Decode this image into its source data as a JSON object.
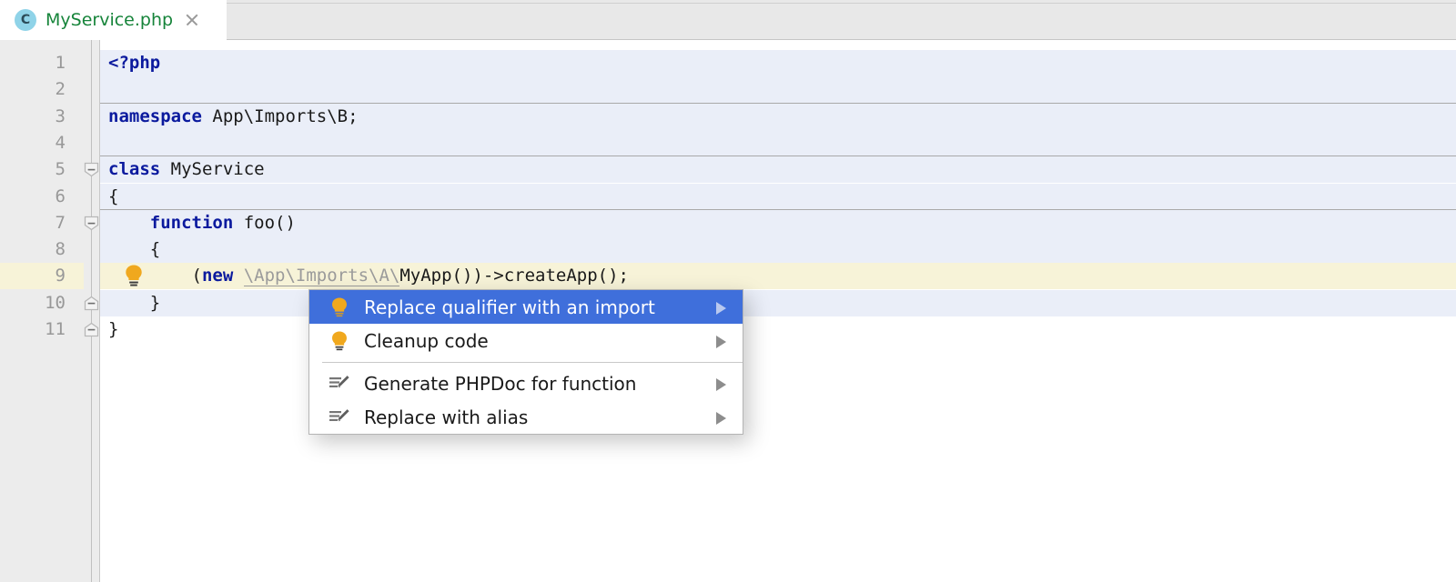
{
  "window": {
    "app": "PhpStorm editor",
    "accent_blue": "#3f6fdb",
    "bulb_color": "#f0a81e",
    "tab_label_color": "#16843a",
    "current_line_color": "#f7f3d8",
    "code_bg_color": "#eaeef8"
  },
  "tabbar": {
    "tabs": [
      {
        "label": "MyService.php",
        "icon": "php-class-icon",
        "icon_letter": "C",
        "close_icon": "close-icon",
        "active": true
      }
    ]
  },
  "editor": {
    "lines": [
      {
        "number": "1",
        "indent": 0,
        "bg": "code",
        "tokens": [
          {
            "t": "<?php",
            "k": "kw"
          }
        ]
      },
      {
        "number": "2",
        "indent": 0,
        "bg": "code",
        "tokens": []
      },
      {
        "number": "3",
        "indent": 0,
        "bg": "code",
        "tokens": [
          {
            "t": "namespace",
            "k": "kw"
          },
          {
            "t": " App\\Imports\\B;",
            "k": "plain"
          }
        ]
      },
      {
        "number": "4",
        "indent": 0,
        "bg": "code",
        "tokens": []
      },
      {
        "number": "5",
        "indent": 0,
        "bg": "code",
        "tokens": [
          {
            "t": "class",
            "k": "kw"
          },
          {
            "t": " MyService",
            "k": "plain"
          }
        ]
      },
      {
        "number": "6",
        "indent": 0,
        "bg": "code",
        "tokens": [
          {
            "t": "{",
            "k": "plain"
          }
        ]
      },
      {
        "number": "7",
        "indent": 0,
        "bg": "code",
        "tokens": [
          {
            "t": "    ",
            "k": "plain"
          },
          {
            "t": "function",
            "k": "kw"
          },
          {
            "t": " foo()",
            "k": "plain"
          }
        ]
      },
      {
        "number": "8",
        "indent": 0,
        "bg": "code",
        "tokens": [
          {
            "t": "    {",
            "k": "plain"
          }
        ]
      },
      {
        "number": "9",
        "indent": 0,
        "bg": "cur",
        "tokens": [
          {
            "t": "        (",
            "k": "plain"
          },
          {
            "t": "new",
            "k": "kw"
          },
          {
            "t": " ",
            "k": "plain"
          },
          {
            "t": "\\App\\Imports\\A\\",
            "k": "qual"
          },
          {
            "t": "MyApp())->createApp();",
            "k": "plain"
          }
        ]
      },
      {
        "number": "10",
        "indent": 0,
        "bg": "code",
        "tokens": [
          {
            "t": "    }",
            "k": "plain"
          }
        ]
      },
      {
        "number": "11",
        "indent": 0,
        "bg": "white",
        "tokens": [
          {
            "t": "}",
            "k": "plain"
          }
        ]
      }
    ],
    "separators_after_lines": [
      "2",
      "4",
      "6"
    ],
    "fold_markers": [
      {
        "line": "5",
        "type": "fold-collapse-start-icon"
      },
      {
        "line": "7",
        "type": "fold-collapse-start-icon"
      },
      {
        "line": "10",
        "type": "fold-collapse-end-icon"
      },
      {
        "line": "11",
        "type": "fold-collapse-end-icon"
      }
    ],
    "gutter_bulb": {
      "line": "9",
      "icon": "intention-bulb-icon"
    }
  },
  "popup": {
    "name": "intention-actions-menu",
    "items": [
      {
        "label": "Replace qualifier with an import",
        "icon": "intention-bulb-icon",
        "selected": true,
        "has_submenu": true,
        "divider_after": false
      },
      {
        "label": "Cleanup code",
        "icon": "intention-bulb-icon",
        "selected": false,
        "has_submenu": true,
        "divider_after": true
      },
      {
        "label": "Generate PHPDoc for function",
        "icon": "edit-pencil-icon",
        "selected": false,
        "has_submenu": true,
        "divider_after": false
      },
      {
        "label": "Replace with alias",
        "icon": "edit-pencil-icon",
        "selected": false,
        "has_submenu": true,
        "divider_after": false
      }
    ]
  }
}
